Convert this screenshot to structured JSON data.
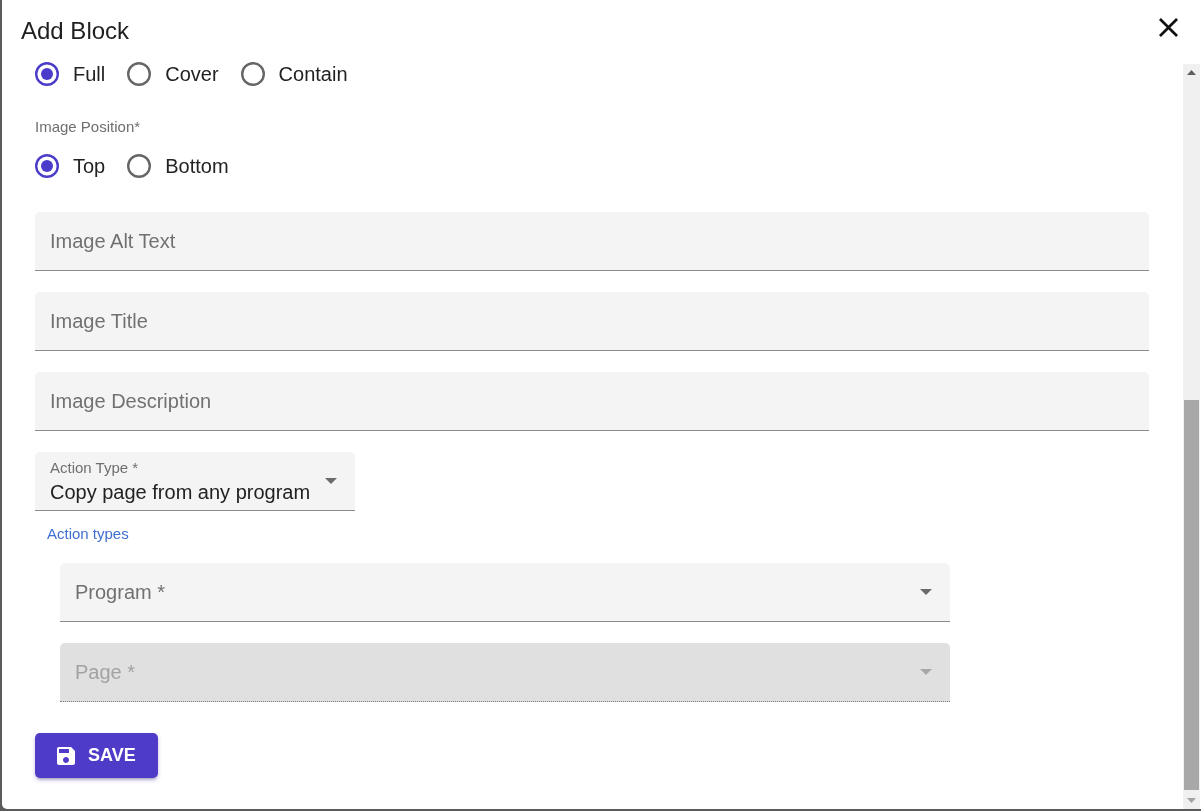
{
  "dialog": {
    "title": "Add Block"
  },
  "fit_options": [
    {
      "label": "Full",
      "selected": true
    },
    {
      "label": "Cover",
      "selected": false
    },
    {
      "label": "Contain",
      "selected": false
    }
  ],
  "image_position": {
    "label": "Image Position*",
    "options": [
      {
        "label": "Top",
        "selected": true
      },
      {
        "label": "Bottom",
        "selected": false
      }
    ]
  },
  "text_fields": [
    {
      "placeholder": "Image Alt Text"
    },
    {
      "placeholder": "Image Title"
    },
    {
      "placeholder": "Image Description"
    }
  ],
  "action_type": {
    "label": "Action Type *",
    "value": "Copy page from any program",
    "helper": "Action types"
  },
  "selects": [
    {
      "label": "Program *",
      "disabled": false
    },
    {
      "label": "Page *",
      "disabled": true
    }
  ],
  "save_button": {
    "label": "SAVE"
  }
}
